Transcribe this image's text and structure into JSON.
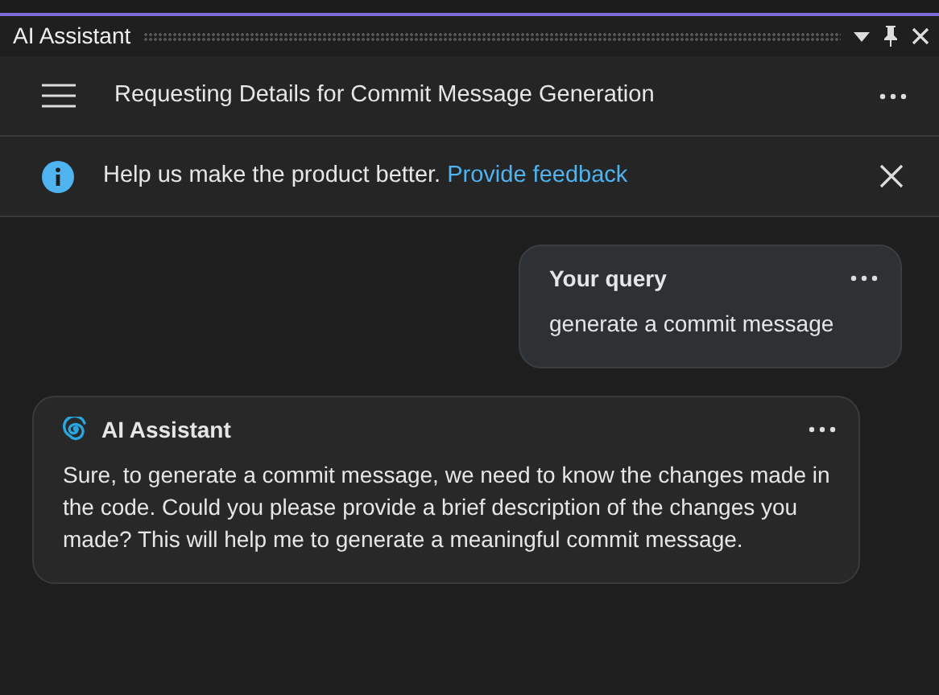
{
  "window": {
    "title": "AI Assistant"
  },
  "header": {
    "title": "Requesting Details for Commit Message Generation"
  },
  "banner": {
    "text": "Help us make the product better.",
    "link": "Provide feedback"
  },
  "messages": [
    {
      "kind": "user",
      "author": "Your query",
      "text": "generate a commit message"
    },
    {
      "kind": "assistant",
      "author": "AI Assistant",
      "text": "Sure, to generate a commit message, we need to know the changes made in the code. Could you please provide a brief description of the changes you made? This will help me to generate a meaningful commit message."
    }
  ]
}
